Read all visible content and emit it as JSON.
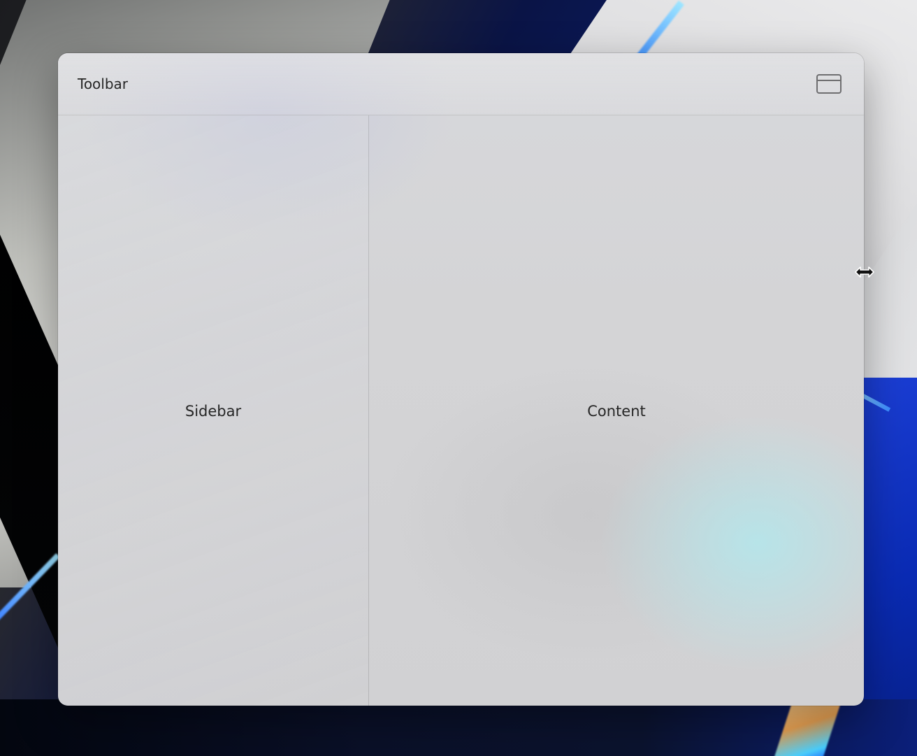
{
  "toolbar": {
    "title": "Toolbar",
    "button_icon": "sidebar-toggle-icon"
  },
  "sidebar": {
    "label": "Sidebar"
  },
  "content": {
    "label": "Content"
  },
  "cursor": {
    "icon": "resize-horizontal-cursor-icon"
  },
  "colors": {
    "window_bg": "#d4d4d6",
    "text": "#262626",
    "divider": "#bdbdc0",
    "icon": "#6e6e70"
  }
}
